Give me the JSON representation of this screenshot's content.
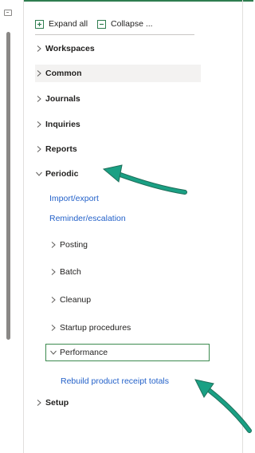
{
  "toolbar": {
    "expand_all_label": "Expand all",
    "collapse_label": "Collapse ..."
  },
  "tree": {
    "workspaces": "Workspaces",
    "common": "Common",
    "journals": "Journals",
    "inquiries": "Inquiries",
    "reports": "Reports",
    "periodic": "Periodic",
    "periodic_children": {
      "import_export": "Import/export",
      "reminder_escalation": "Reminder/escalation",
      "posting": "Posting",
      "batch": "Batch",
      "cleanup": "Cleanup",
      "startup_procedures": "Startup procedures",
      "performance": "Performance",
      "rebuild_product_receipt_totals": "Rebuild product receipt totals"
    },
    "setup": "Setup"
  },
  "colors": {
    "accent_green": "#2e7d4f",
    "link_blue": "#2361c9",
    "annotation_arrow": "#1aa084",
    "highlight_bg": "#f3f2f1"
  },
  "icons": {
    "expand_all": "expand-all-icon",
    "collapse": "collapse-icon",
    "chevron_right": "chevron-right-icon",
    "chevron_down": "chevron-down-icon",
    "pin": "pin-icon"
  }
}
